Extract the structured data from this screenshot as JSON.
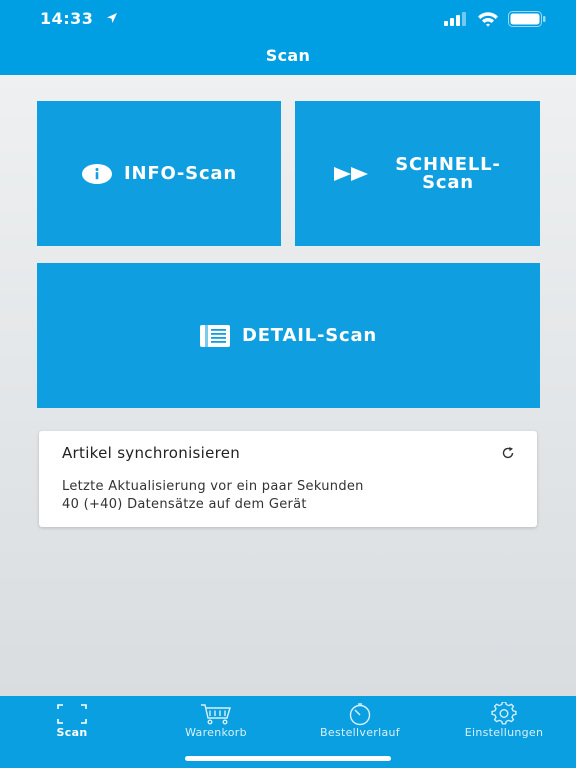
{
  "status_bar": {
    "time": "14:33",
    "icons": [
      "location-arrow-icon",
      "signal-bars-icon",
      "wifi-icon",
      "battery-icon"
    ]
  },
  "nav": {
    "title": "Scan"
  },
  "tiles": {
    "info": {
      "label": "INFO-Scan",
      "icon": "info-circle-icon"
    },
    "schnell": {
      "label_line1": "SCHNELL-",
      "label_line2": "Scan",
      "icon": "fast-forward-icon"
    },
    "detail": {
      "label": "DETAIL-Scan",
      "icon": "document-list-icon"
    }
  },
  "sync": {
    "title": "Artikel synchronisieren",
    "line1": "Letzte Aktualisierung vor ein paar Sekunden",
    "line2": "40 (+40) Datensätze auf dem Gerät",
    "icon": "refresh-icon"
  },
  "tabs": [
    {
      "label": "Scan",
      "icon": "scan-frame-icon",
      "active": true
    },
    {
      "label": "Warenkorb",
      "icon": "cart-icon",
      "active": false
    },
    {
      "label": "Bestellverlauf",
      "icon": "timer-icon",
      "active": false
    },
    {
      "label": "Einstellungen",
      "icon": "gear-icon",
      "active": false
    }
  ],
  "colors": {
    "brand": "#009fe3",
    "tile": "#0f9fe0",
    "background": "#e6e9eb",
    "card": "#ffffff"
  }
}
